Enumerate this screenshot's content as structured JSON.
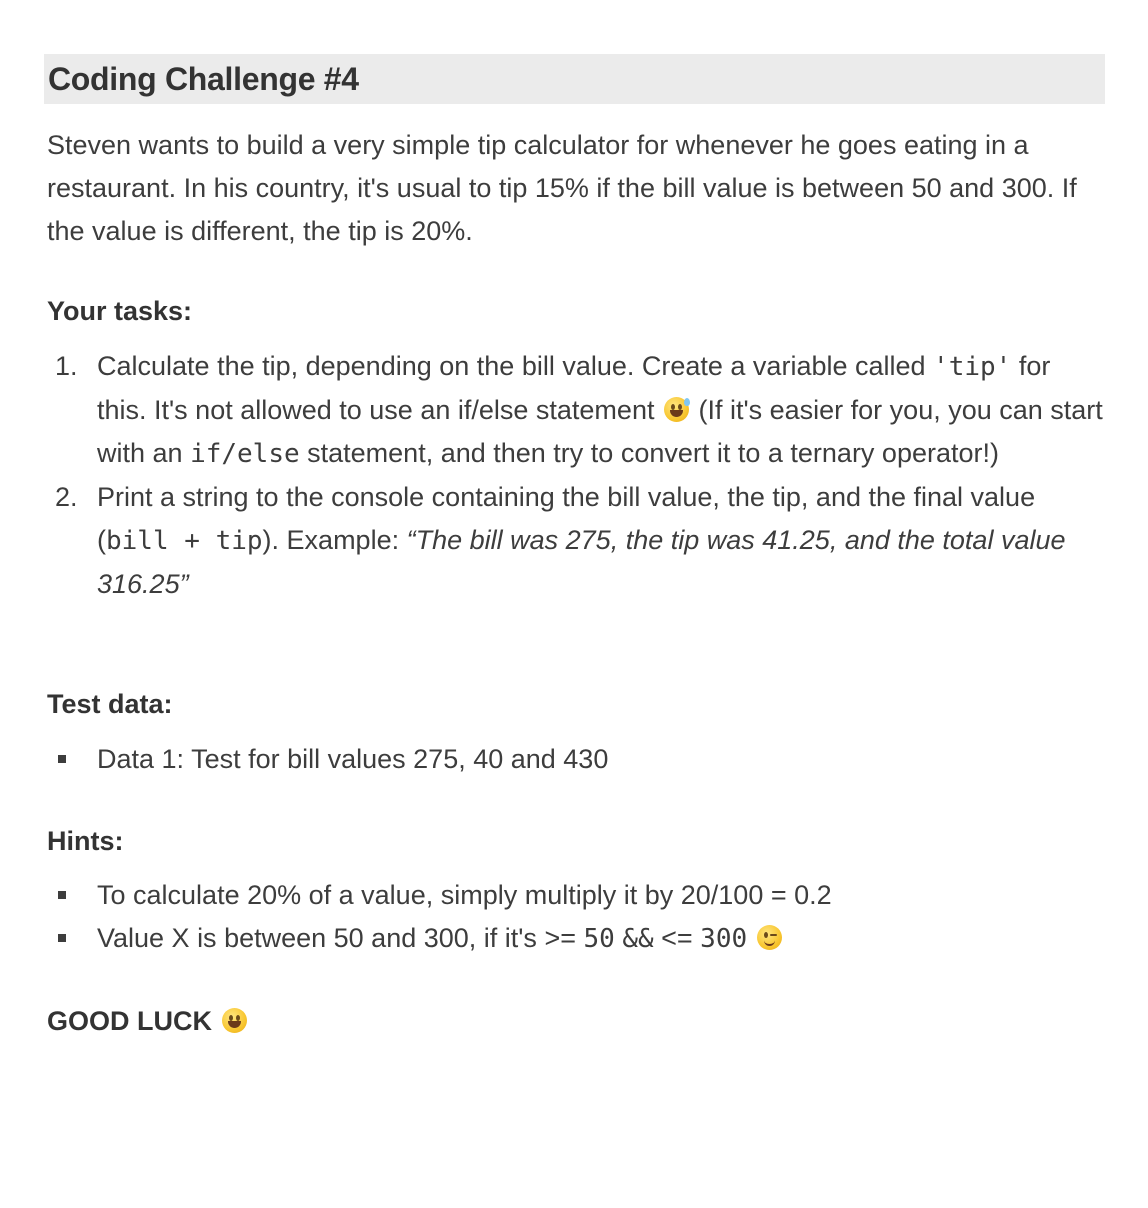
{
  "title": "Coding Challenge #4",
  "intro": "Steven wants to build a very simple tip calculator for whenever he goes eating in a restaurant. In his country, it's usual to tip 15% if the bill value is between 50 and 300. If the value is different, the tip is 20%.",
  "tasks": {
    "heading": "Your tasks:",
    "items": [
      {
        "number": "1.",
        "part1": "Calculate the tip, depending on the bill value. Create a variable called ",
        "code1": "'tip'",
        "part2": " for this. It's not allowed to use an if/else statement ",
        "emoji": "grinning-sweat-emoji",
        "part3": " (If it's easier for you, you can start with an ",
        "code2": "if/else",
        "part4": " statement, and then try to convert it to a ternary operator!)"
      },
      {
        "number": "2.",
        "part1": "Print a string to the console containing the bill value, the tip, and the final value (",
        "code1": "bill + tip",
        "part2": "). Example: ",
        "example": "“The bill was 275, the tip was 41.25, and the total value 316.25”"
      }
    ]
  },
  "test_data": {
    "heading": "Test data:",
    "items": [
      "Data 1: Test for bill values 275, 40 and 430"
    ]
  },
  "hints": {
    "heading": "Hints:",
    "item1": "To calculate 20% of a value, simply multiply it by 20/100 = 0.2",
    "item2_text": "Value X is between 50 and 300, if it's >= ",
    "item2_code1": "50",
    "item2_mid": " ",
    "item2_code2": "&&",
    "item2_lte": " <= ",
    "item2_code3": "300",
    "item2_emoji": "winking-face-emoji"
  },
  "closing": {
    "text": "GOOD LUCK",
    "emoji": "grinning-face-emoji"
  }
}
